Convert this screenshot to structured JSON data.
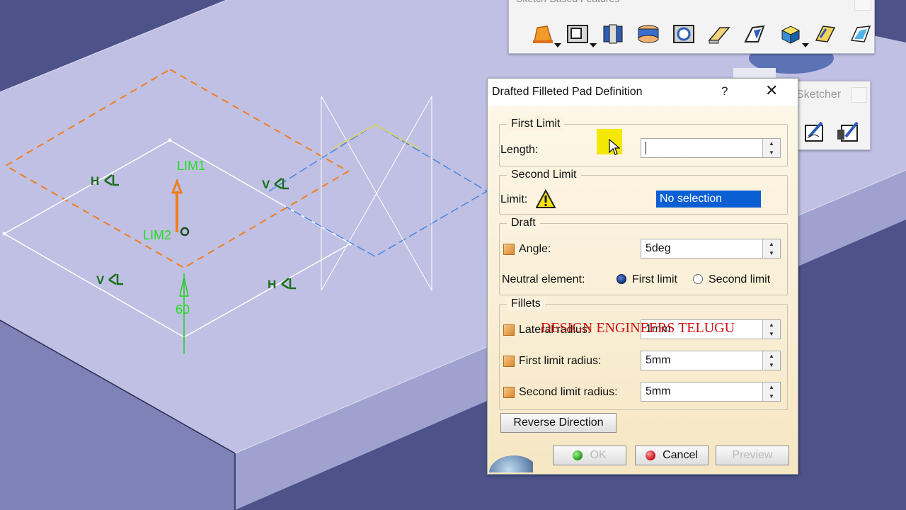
{
  "viewport": {
    "sketch_labels": {
      "lim1": "LIM1",
      "lim2": "LIM2",
      "dim": "60",
      "c1": "H",
      "c2": "V",
      "c3": "V",
      "c4": "H"
    }
  },
  "toolbar_sbf": {
    "title": "Sketch-Based Features",
    "icons": [
      "pad-icon",
      "pocket-icon",
      "shaft-icon",
      "groove-icon",
      "hole-icon",
      "rib-icon",
      "slot-icon",
      "solid-combine-icon",
      "multi-sections-solid-icon",
      "removed-multi-sections-icon"
    ]
  },
  "toolbar_sketcher": {
    "title": "Sketcher",
    "icons": [
      "sketch-icon",
      "positioned-sketch-icon"
    ]
  },
  "dialog": {
    "title": "Drafted Filleted Pad Definition",
    "help": "?",
    "close": "✕",
    "first_limit": {
      "legend": "First Limit",
      "length_label": "Length:",
      "length_value": ""
    },
    "second_limit": {
      "legend": "Second Limit",
      "limit_label": "Limit:",
      "limit_value": "No selection"
    },
    "draft": {
      "legend": "Draft",
      "angle_label": "Angle:",
      "angle_value": "5deg",
      "neutral_label": "Neutral element:",
      "option_first": "First limit",
      "option_second": "Second limit",
      "selected": "First limit"
    },
    "fillets": {
      "legend": "Fillets",
      "lateral_label": "Lateral radius:",
      "lateral_value": "1mm",
      "first_label": "First limit radius:",
      "first_value": "5mm",
      "second_label": "Second limit radius:",
      "second_value": "5mm"
    },
    "reverse_label": "Reverse Direction",
    "ok_label": "OK",
    "cancel_label": "Cancel",
    "preview_label": "Preview"
  },
  "watermark": "DESIGN ENGINEERS TELUGU",
  "colors": {
    "background": "#4a4f86",
    "top_face": "#c0c0e4",
    "front_face": "#7f82b6",
    "side_face": "#9a9ccc",
    "profile": "#ffffff",
    "constraint": "#1a6e1a",
    "dashed_orange": "#f07e1c",
    "dashed_blue": "#4a86e0",
    "selection": "#0a5fd2",
    "watermark": "#cc1111"
  }
}
